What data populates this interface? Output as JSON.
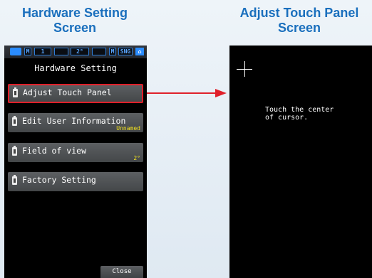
{
  "captions": {
    "left_line1": "Hardware Setting",
    "left_line2": "Screen",
    "right_line1": "Adjust Touch Panel",
    "right_line2": "Screen"
  },
  "status_bar": {
    "mode": "M",
    "number": "1",
    "angle": "2°",
    "mem": "M",
    "sng": "SNG"
  },
  "hardware_screen": {
    "title": "Hardware Setting",
    "menu": [
      {
        "label": "Adjust Touch Panel",
        "value": ""
      },
      {
        "label": "Edit User Information",
        "value": "Unnamed"
      },
      {
        "label": "Field of view",
        "value": "2°"
      },
      {
        "label": "Factory Setting",
        "value": ""
      }
    ],
    "close_label": "Close"
  },
  "touch_screen": {
    "message_line1": "Touch the center",
    "message_line2": "of cursor."
  },
  "colors": {
    "caption": "#1a6fbd",
    "highlight": "#e0202a",
    "value_text": "#f0e020",
    "menu_bg": "#4f5255"
  },
  "icons": [
    "battery-icon",
    "lock-icon",
    "menu-item-icon",
    "cursor-crosshair-icon",
    "arrow-icon"
  ]
}
